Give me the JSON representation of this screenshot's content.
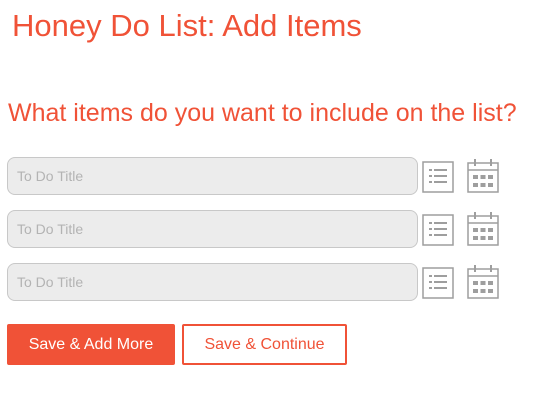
{
  "page": {
    "title": "Honey Do List: Add Items",
    "question": "What items do you want to include on the list?"
  },
  "items": [
    {
      "placeholder": "To Do Title",
      "value": "",
      "list_icon": "list-icon",
      "calendar_icon": "calendar-icon"
    },
    {
      "placeholder": "To Do Title",
      "value": "",
      "list_icon": "list-icon",
      "calendar_icon": "calendar-icon"
    },
    {
      "placeholder": "To Do Title",
      "value": "",
      "list_icon": "list-icon",
      "calendar_icon": "calendar-icon"
    }
  ],
  "actions": {
    "save_add_more": "Save & Add More",
    "save_continue": "Save & Continue"
  },
  "colors": {
    "accent": "#f05237",
    "input_bg": "#ececec",
    "input_border": "#c8c8c8",
    "icon": "#9e9e9e",
    "placeholder": "#b3b3b3"
  }
}
